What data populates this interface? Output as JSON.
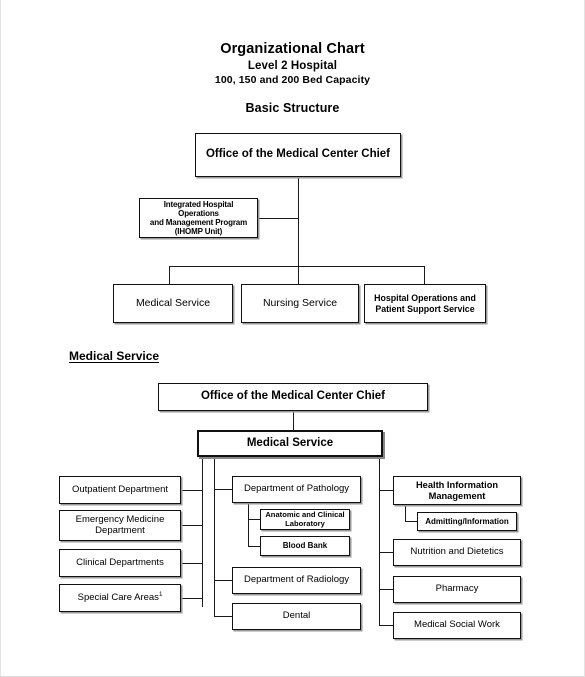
{
  "document": {
    "title": "Organizational Chart",
    "subtitle_1": "Level 2 Hospital",
    "subtitle_2": "100, 150 and 200 Bed Capacity",
    "section_1_heading": "Basic Structure",
    "section_2_heading": "Medical Service"
  },
  "basic_structure": {
    "root": "Office of the Medical Center Chief",
    "staff_unit": "Integrated Hospital Operations and Management  Program (IHOMP Unit)",
    "staff_unit_lines": [
      "Integrated Hospital Operations",
      "and Management  Program",
      "(IHOMP Unit)"
    ],
    "divisions": [
      "Medical Service",
      "Nursing Service",
      "Hospital Operations and Patient Support Service"
    ],
    "division_3_lines": [
      "Hospital Operations and",
      "Patient Support Service"
    ]
  },
  "medical_service": {
    "root": "Office of the Medical Center Chief",
    "head": "Medical Service",
    "column_left": [
      {
        "label": "Outpatient Department",
        "lines": [
          "Outpatient Department"
        ]
      },
      {
        "label": "Emergency Medicine Department",
        "lines": [
          "Emergency Medicine",
          "Department"
        ]
      },
      {
        "label": "Clinical Departments",
        "lines": [
          "Clinical Departments"
        ]
      },
      {
        "label": "Special Care Areas",
        "footnote": "1",
        "lines": [
          "Special Care Areas"
        ]
      }
    ],
    "column_middle": [
      {
        "label": "Department of Pathology"
      },
      {
        "label": "Department of Radiology"
      },
      {
        "label": "Dental"
      }
    ],
    "pathology_children": [
      {
        "label": "Anatomic  and Clinical Laboratory",
        "lines": [
          "Anatomic  and Clinical",
          "Laboratory"
        ]
      },
      {
        "label": "Blood Bank",
        "lines": [
          "Blood Bank"
        ]
      }
    ],
    "column_right": [
      {
        "label": "Health Information Management",
        "lines": [
          "Health Information",
          "Management"
        ]
      },
      {
        "label": "Nutrition and Dietetics",
        "lines": [
          "Nutrition and Dietetics"
        ]
      },
      {
        "label": "Pharmacy",
        "lines": [
          "Pharmacy"
        ]
      },
      {
        "label": "Medical Social Work",
        "lines": [
          "Medical Social Work"
        ]
      }
    ],
    "him_children": [
      {
        "label": "Admitting/Information",
        "lines": [
          "Admitting/Information"
        ]
      }
    ]
  },
  "colors": {
    "line": "#1a1a1a",
    "box_border": "#111111",
    "box_fill": "#ffffff",
    "shadow": "#9a9a9a",
    "page_border": "#e3e3e3"
  }
}
